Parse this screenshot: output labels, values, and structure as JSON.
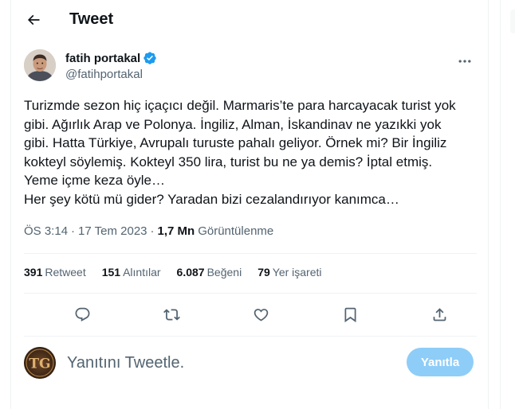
{
  "header": {
    "back_icon": "arrow-left-icon",
    "title": "Tweet"
  },
  "author": {
    "display_name": "fatih portakal",
    "handle": "@fatihportakal",
    "verified": true,
    "verified_color": "#1d9bf0"
  },
  "tweet": {
    "text": "Turizmde sezon hiç içaçıcı değil. Marmaris’te para harcayacak turist yok\ngibi. Ağırlık Arap ve Polonya. İngiliz, Alman, İskandinav ne yazıkki yok\ngibi. Hatta Türkiye, Avrupalı turuste pahalı geliyor. Örnek mi? Bir İngiliz\nkokteyl söylemiş. Kokteyl 350 lira, turist bu ne ya demis? İptal etmiş.\nYeme içme keza öyle…\nHer şey kötü mü gider? Yaradan bizi cezalandırıyor kanımca…",
    "time": "ÖS 3:14",
    "date": "17 Tem 2023",
    "separator": "·",
    "views_count": "1,7 Mn",
    "views_label": "Görüntülenme"
  },
  "stats": [
    {
      "count": "391",
      "label": "Retweet"
    },
    {
      "count": "151",
      "label": "Alıntılar"
    },
    {
      "count": "6.087",
      "label": "Beğeni"
    },
    {
      "count": "79",
      "label": "Yer işareti"
    }
  ],
  "actions": {
    "icons": [
      "reply-icon",
      "retweet-icon",
      "like-icon",
      "bookmark-icon",
      "share-icon"
    ],
    "icon_color": "#536471"
  },
  "reply": {
    "avatar_initials": "TG",
    "placeholder": "Yanıtını Tweetle.",
    "button_label": "Yanıtla",
    "button_color": "#8ecdf8"
  }
}
